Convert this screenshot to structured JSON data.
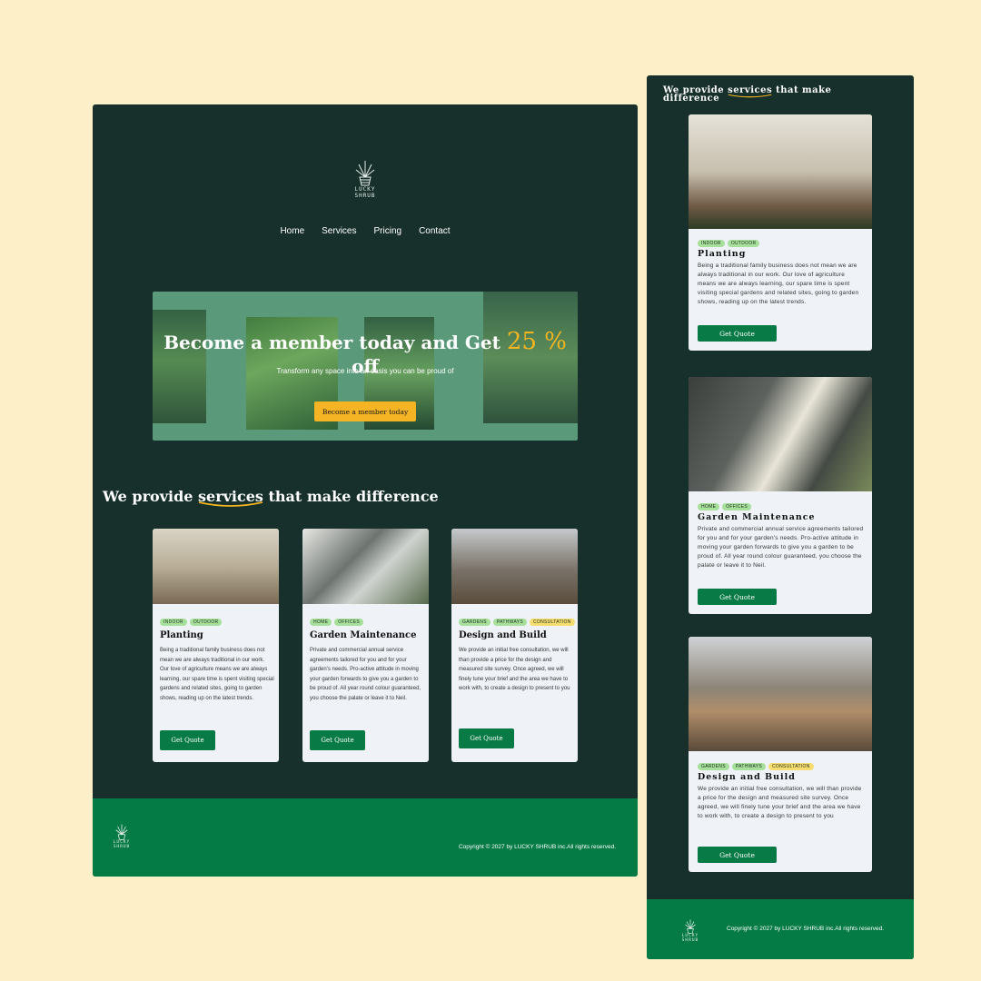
{
  "brand": {
    "name_line1": "LUCKY",
    "name_line2": "SHRUB"
  },
  "nav": {
    "home": "Home",
    "services": "Services",
    "pricing": "Pricing",
    "contact": "Contact"
  },
  "hero": {
    "title_pre": "Become a member today and Get ",
    "title_pct": "25 %",
    "title_post": " off",
    "subtitle": "Transform any space into an oasis you can be proud of",
    "cta": "Become a member today"
  },
  "services": {
    "title_pre": "We provide ",
    "title_hl": "services",
    "title_post": " that make difference"
  },
  "cards": [
    {
      "tags": [
        "INDOOR",
        "OUTDOOR"
      ],
      "title": "Planting",
      "text": "Being a traditional family business does not mean we are always traditional in our work. Our love of agriculture means we are always learning, our spare time is spent visiting special gardens and related sites, going to garden shows, reading up on the latest trends.",
      "button": "Get Quote"
    },
    {
      "tags": [
        "HOME",
        "OFFICES"
      ],
      "title": "Garden Maintenance",
      "text": "Private and commercial annual service agreements tailored for you and for your garden's needs. Pro-active attitude in moving your garden forwards to give you a garden to be proud of. All year round colour guaranteed, you choose the palate or leave it to Neil.",
      "button": "Get Quote"
    },
    {
      "tags": [
        "GARDENS",
        "PATHWAYS",
        "CONSULTATION"
      ],
      "title": "Design and Build",
      "text": "We provide an initial free consultation, we will than provide a price for the design and measured site survey. Once agreed, we will finely tune your brief and the area we have to work with, to create a design to present to you",
      "button": "Get Quote"
    }
  ],
  "footer": {
    "copyright": "Copyright © 2027 by LUCKY SHRUB inc.All rights reserved."
  },
  "colors": {
    "page_bg": "#fdf0c8",
    "panel": "#17302b",
    "hero": "#5a9a7a",
    "accent": "#f5b423",
    "button": "#087a45",
    "footer": "#047a45"
  }
}
